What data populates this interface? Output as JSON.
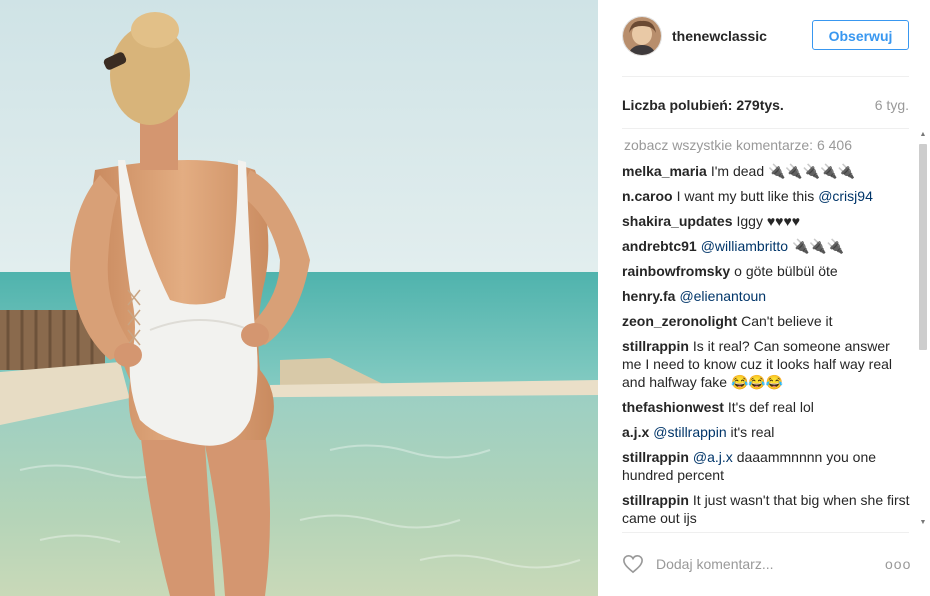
{
  "post": {
    "image_alt": "Kobieta w białym stroju kąpielowym stojąca w basenie nad morzem",
    "author": {
      "username": "thenewclassic"
    },
    "follow_label": "Obserwuj",
    "likes_label": "Liczba polubień:",
    "likes_count": "279tys.",
    "time_ago": "6 tyg."
  },
  "comments": {
    "view_all": "zobacz wszystkie komentarze: 6 406",
    "items": [
      {
        "user": "melka_maria",
        "text": "I'm dead",
        "emoji": "🔌🔌🔌🔌🔌"
      },
      {
        "user": "n.caroo",
        "text": "I want my butt like this",
        "mention": "@crisj94"
      },
      {
        "user": "shakira_updates",
        "text": "Iggy ♥♥♥♥"
      },
      {
        "user": "andrebtc91",
        "mention": "@williambritto",
        "emoji": "🔌🔌🔌"
      },
      {
        "user": "rainbowfromsky",
        "text": "o göte bülbül öte"
      },
      {
        "user": "henry.fa",
        "mention": "@elienantoun"
      },
      {
        "user": "zeon_zeronolight",
        "text": "Can't believe it"
      },
      {
        "user": "stillrappin",
        "text": "Is it real? Can someone answer me I need to know cuz it looks half way real and halfway fake 😂😂😂"
      },
      {
        "user": "thefashionwest",
        "text": "It's def real lol"
      },
      {
        "user": "a.j.x",
        "mention": "@stillrappin",
        "text": "it's real"
      },
      {
        "user": "stillrappin",
        "mention": "@a.j.x",
        "text": "daaammnnnn you one hundred percent"
      },
      {
        "user": "stillrappin",
        "text": "It just wasn't that big when she first came out ijs"
      }
    ]
  },
  "footer": {
    "comment_placeholder": "Dodaj komentarz...",
    "more_label": "ooo"
  },
  "icons": {
    "like": "heart-icon",
    "more": "more-options-icon"
  },
  "colors": {
    "accent": "#3897f0",
    "mention": "#003569",
    "muted": "#999999"
  }
}
